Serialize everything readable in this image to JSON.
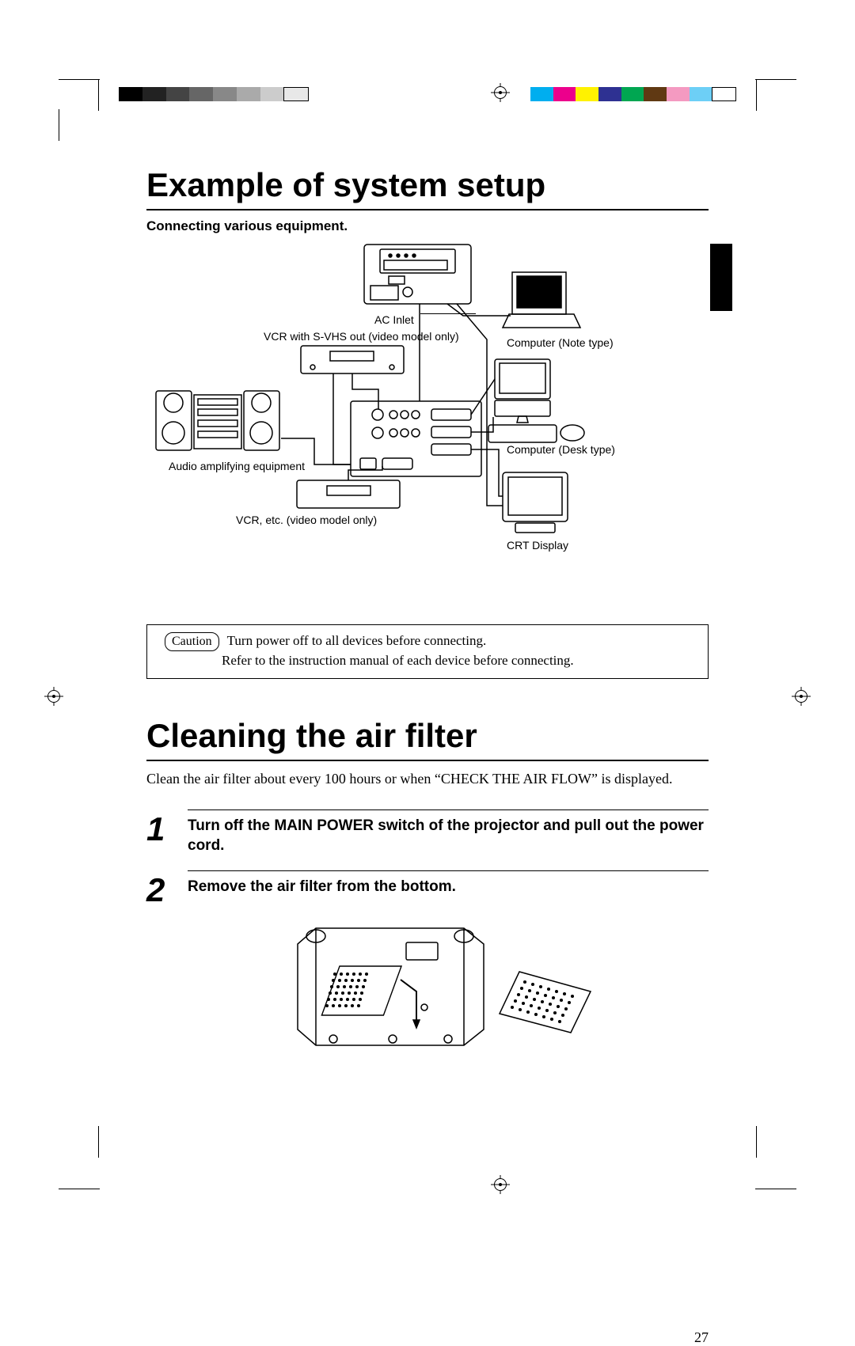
{
  "section1": {
    "title": "Example of system setup",
    "subhead": "Connecting various equipment.",
    "labels": {
      "ac_inlet": "AC Inlet",
      "vcr_svhs": "VCR with S-VHS out (video model only)",
      "computer_note": "Computer (Note type)",
      "computer_desk": "Computer (Desk type)",
      "audio": "Audio amplifying equipment",
      "vcr_etc": "VCR, etc. (video model only)",
      "crt": "CRT Display"
    },
    "caution": {
      "label": "Caution",
      "line1": "Turn power off to all devices before connecting.",
      "line2": "Refer to the instruction manual of each device before connecting."
    }
  },
  "section2": {
    "title": "Cleaning the air filter",
    "intro": "Clean the air filter about every 100 hours or when “CHECK THE AIR FLOW” is displayed.",
    "steps": [
      {
        "num": "1",
        "text": "Turn off the MAIN POWER switch of the projector and pull out the power cord."
      },
      {
        "num": "2",
        "text": "Remove the air filter from the bottom."
      }
    ]
  },
  "pagenum": "27"
}
